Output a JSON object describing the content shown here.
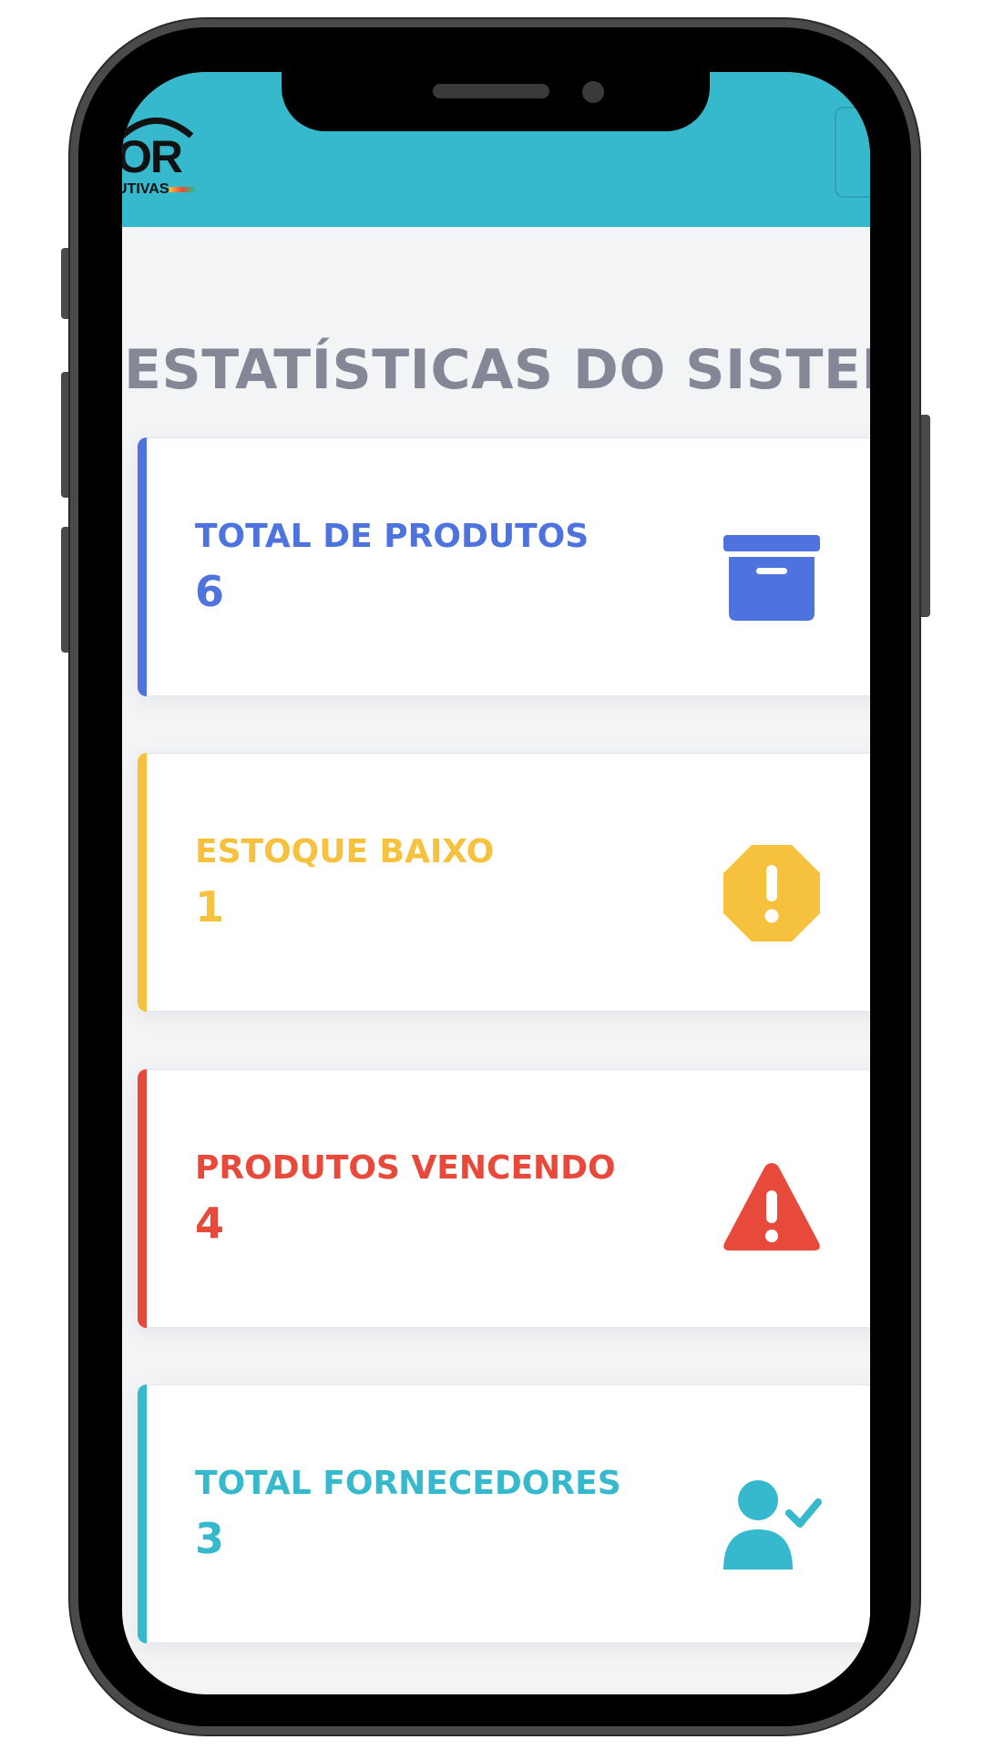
{
  "header": {
    "logo_text": "OR",
    "logo_subtext": "UTIVAS"
  },
  "page_title": "ESTATÍSTICAS DO SISTEMA",
  "stats": [
    {
      "label": "TOTAL DE PRODUTOS",
      "value": "6",
      "icon": "archive-box-icon",
      "color": "#4e73df"
    },
    {
      "label": "ESTOQUE BAIXO",
      "value": "1",
      "icon": "exclamation-octagon-icon",
      "color": "#f6c23e"
    },
    {
      "label": "PRODUTOS VENCENDO",
      "value": "4",
      "icon": "warning-triangle-icon",
      "color": "#e74a3b"
    },
    {
      "label": "TOTAL FORNECEDORES",
      "value": "3",
      "icon": "user-check-icon",
      "color": "#36b9cc"
    }
  ],
  "colors": {
    "header_bg": "#36b9cc",
    "title": "#858796",
    "background": "#f3f4f6"
  }
}
